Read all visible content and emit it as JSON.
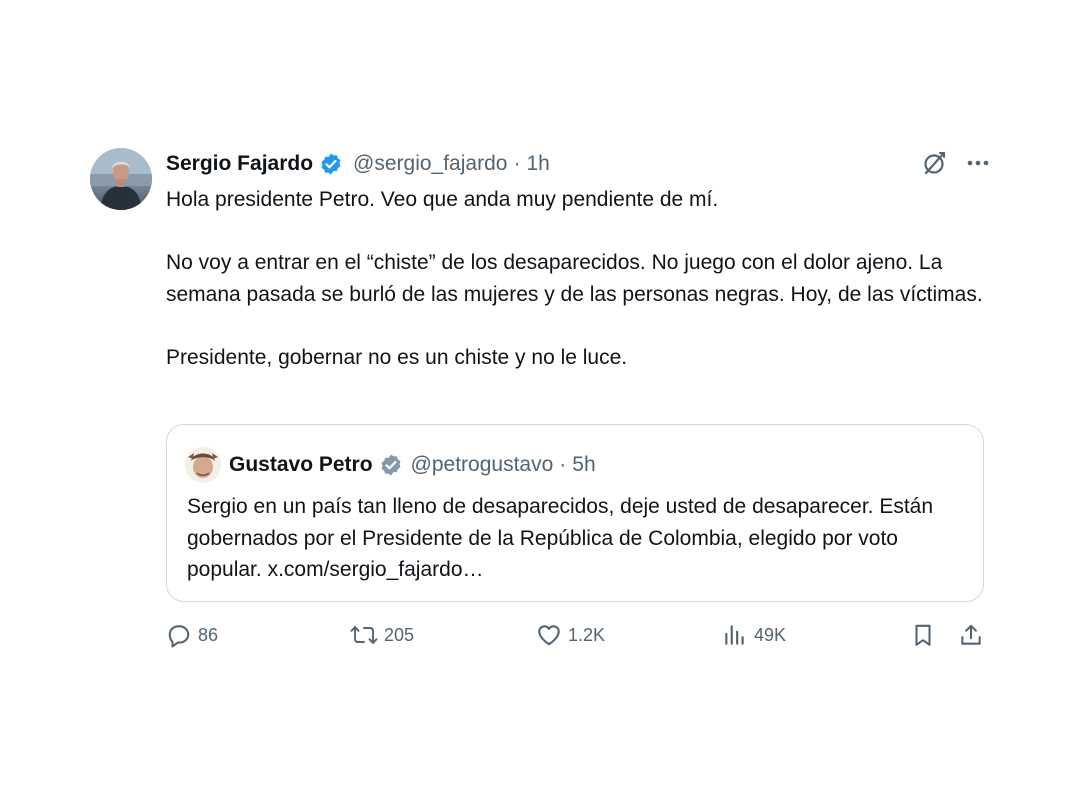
{
  "tweet": {
    "author": {
      "name": "Sergio Fajardo",
      "handle": "@sergio_fajardo",
      "separator": "·",
      "time": "1h"
    },
    "paragraphs": [
      "Hola presidente Petro. Veo que anda muy pendiente de mí.",
      "No voy a entrar en el “chiste” de los desaparecidos. No juego con el dolor ajeno. La semana pasada se burló de las mujeres y de las personas negras. Hoy, de las víctimas.",
      "Presidente, gobernar no es un chiste y no le luce."
    ],
    "icons": {
      "verified": "verified-badge-icon",
      "grok": "grok-icon",
      "more": "more-icon"
    }
  },
  "quote": {
    "author": {
      "name": "Gustavo Petro",
      "handle": "@petrogustavo",
      "separator": "·",
      "time": "5h"
    },
    "text": "Sergio en un país tan lleno de desaparecidos, deje usted de desaparecer. Están gobernados por el Presidente de la República de Colombia, elegido por voto popular. x.com/sergio_fajardo…"
  },
  "actions": {
    "replies": "86",
    "reposts": "205",
    "likes": "1.2K",
    "views": "49K"
  },
  "colors": {
    "text": "#0f1419",
    "secondary": "#536471",
    "verified_blue": "#1d9bf0",
    "verified_gray": "#829aab",
    "border": "#cfd9de"
  }
}
